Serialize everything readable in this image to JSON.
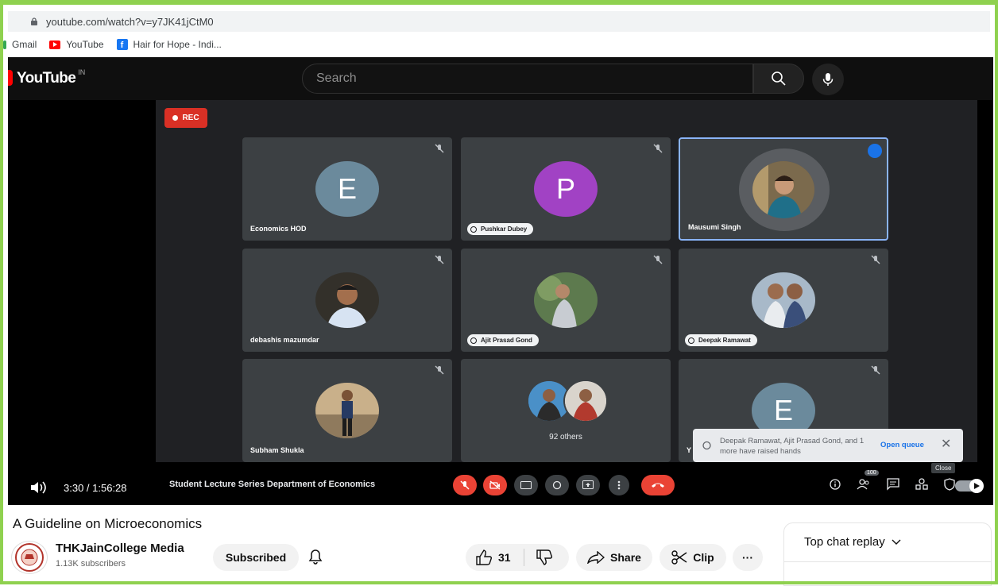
{
  "browser": {
    "url": "youtube.com/watch?v=y7JK41jCtM0",
    "bookmarks": [
      {
        "label": "Gmail",
        "icon": "gmail-icon"
      },
      {
        "label": "YouTube",
        "icon": "youtube-icon"
      },
      {
        "label": "Hair for Hope - Indi...",
        "icon": "facebook-icon"
      }
    ]
  },
  "youtube": {
    "logo_text": "YouTube",
    "country_code": "IN",
    "search_placeholder": "Search"
  },
  "meet": {
    "rec_label": "REC",
    "tiles": [
      {
        "name": "Economics HOD",
        "initial": "E",
        "avatar_color": "#6b8a9c",
        "hand_raised": false
      },
      {
        "name": "Pushkar Dubey",
        "initial": "P",
        "avatar_color": "#a142c4",
        "hand_raised": true
      },
      {
        "name": "Mausumi Singh",
        "initial": "",
        "hand_raised": false,
        "speaking": true
      },
      {
        "name": "debashis mazumdar",
        "initial": "",
        "hand_raised": false
      },
      {
        "name": "Ajit Prasad Gond",
        "initial": "",
        "hand_raised": true
      },
      {
        "name": "Deepak Ramawat",
        "initial": "",
        "hand_raised": true
      },
      {
        "name": "Subham Shukla",
        "initial": "",
        "hand_raised": false
      },
      {
        "name": "92 others",
        "initial": "",
        "hand_raised": false
      },
      {
        "name": "Y",
        "initial": "E",
        "avatar_color": "#6b8a9c",
        "hand_raised": false
      }
    ],
    "toast": {
      "message": "Deepak Ramawat, Ajit Prasad Gond, and 1 more have raised hands",
      "action": "Open queue",
      "close_tooltip": "Close"
    },
    "meeting_title": "Student Lecture Series Department of Economics",
    "participants_badge": "100"
  },
  "player": {
    "time": "3:30 / 1:56:28"
  },
  "video": {
    "title": "A Guideline on Microeconomics",
    "channel_name": "THKJainCollege Media",
    "subscribers": "1.13K subscribers",
    "subscribe_label": "Subscribed",
    "likes": "31",
    "share_label": "Share",
    "clip_label": "Clip",
    "more_label": "···"
  },
  "chat": {
    "header": "Top chat replay"
  },
  "colors": {
    "frame": "#8fd14f",
    "meet_bg": "#202124",
    "tile_bg": "#3c4043",
    "rec_red": "#d93025",
    "active_border": "#8ab4f8"
  }
}
